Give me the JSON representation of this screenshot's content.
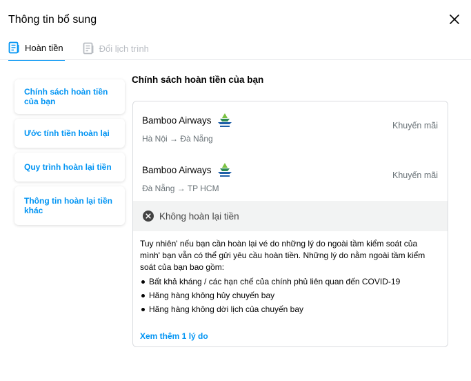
{
  "header": {
    "title": "Thông tin bổ sung",
    "close_icon": "close-icon"
  },
  "tabs": [
    {
      "label": "Hoàn tiền",
      "icon": "document-list-icon",
      "active": true
    },
    {
      "label": "Đổi lịch trình",
      "icon": "document-list-icon",
      "active": false
    }
  ],
  "side_nav": {
    "items": [
      {
        "label": "Chính sách hoàn tiền của bạn"
      },
      {
        "label": "Ước tính tiền hoàn lại"
      },
      {
        "label": "Quy trình hoàn lại tiền"
      },
      {
        "label": "Thông tin hoàn lại tiền khác"
      }
    ]
  },
  "main": {
    "title": "Chính sách hoàn tiền của bạn",
    "flights": [
      {
        "airline": "Bamboo Airways",
        "logo_icon": "bamboo-airways-logo-icon",
        "route": "Hà Nội → Đà Nẵng",
        "fare": "Khuyến mãi"
      },
      {
        "airline": "Bamboo Airways",
        "logo_icon": "bamboo-airways-logo-icon",
        "route": "Đà Nẵng → TP HCM",
        "fare": "Khuyến mãi"
      }
    ],
    "status": {
      "label": "Không hoàn lại tiền",
      "icon": "x-circle-icon"
    },
    "description": "Tuy nhiên' nếu bạn cần hoàn lại vé do những lý do ngoài tầm kiểm soát của mình' bạn vẫn có thể gửi yêu cầu hoàn tiền. Những lý do nằm ngoài tầm kiểm soát của bạn bao gồm:",
    "reasons": [
      "Bất khả kháng / các hạn chế của chính phủ liên quan đến COVID-19",
      "Hãng hàng không hủy chuyến bay",
      "Hãng hàng không dời lịch của chuyến bay"
    ],
    "see_more": "Xem thêm 1 lý do"
  },
  "colors": {
    "accent": "#0194f3",
    "text": "#030303",
    "muted": "#687176",
    "status_bg": "#f2f3f3"
  }
}
